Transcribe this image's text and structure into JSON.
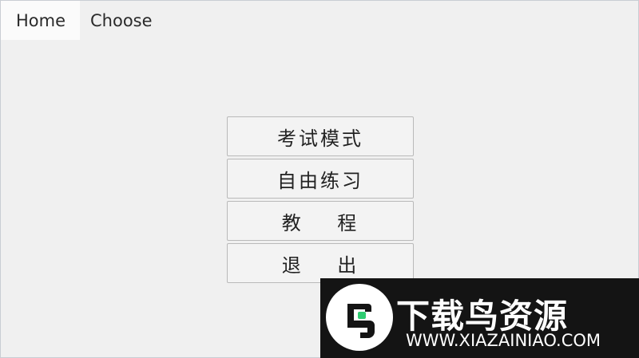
{
  "tabs": [
    {
      "label": "Home",
      "active": true
    },
    {
      "label": "Choose",
      "active": false
    }
  ],
  "menu": {
    "items": [
      {
        "label": "考试模式"
      },
      {
        "label": "自由练习"
      },
      {
        "label": "教    程"
      },
      {
        "label": "退    出"
      }
    ]
  },
  "watermark": {
    "title": "下载鸟资源",
    "url": "WWW.XIAZAINIAO.COM",
    "logo_icon": "bird-logo-icon"
  },
  "colors": {
    "background": "#f0f0f0",
    "active_tab": "#fbfbfb",
    "button_border": "#b9b9b9",
    "watermark_bg": "#141414",
    "logo_accent": "#2ecc71"
  }
}
